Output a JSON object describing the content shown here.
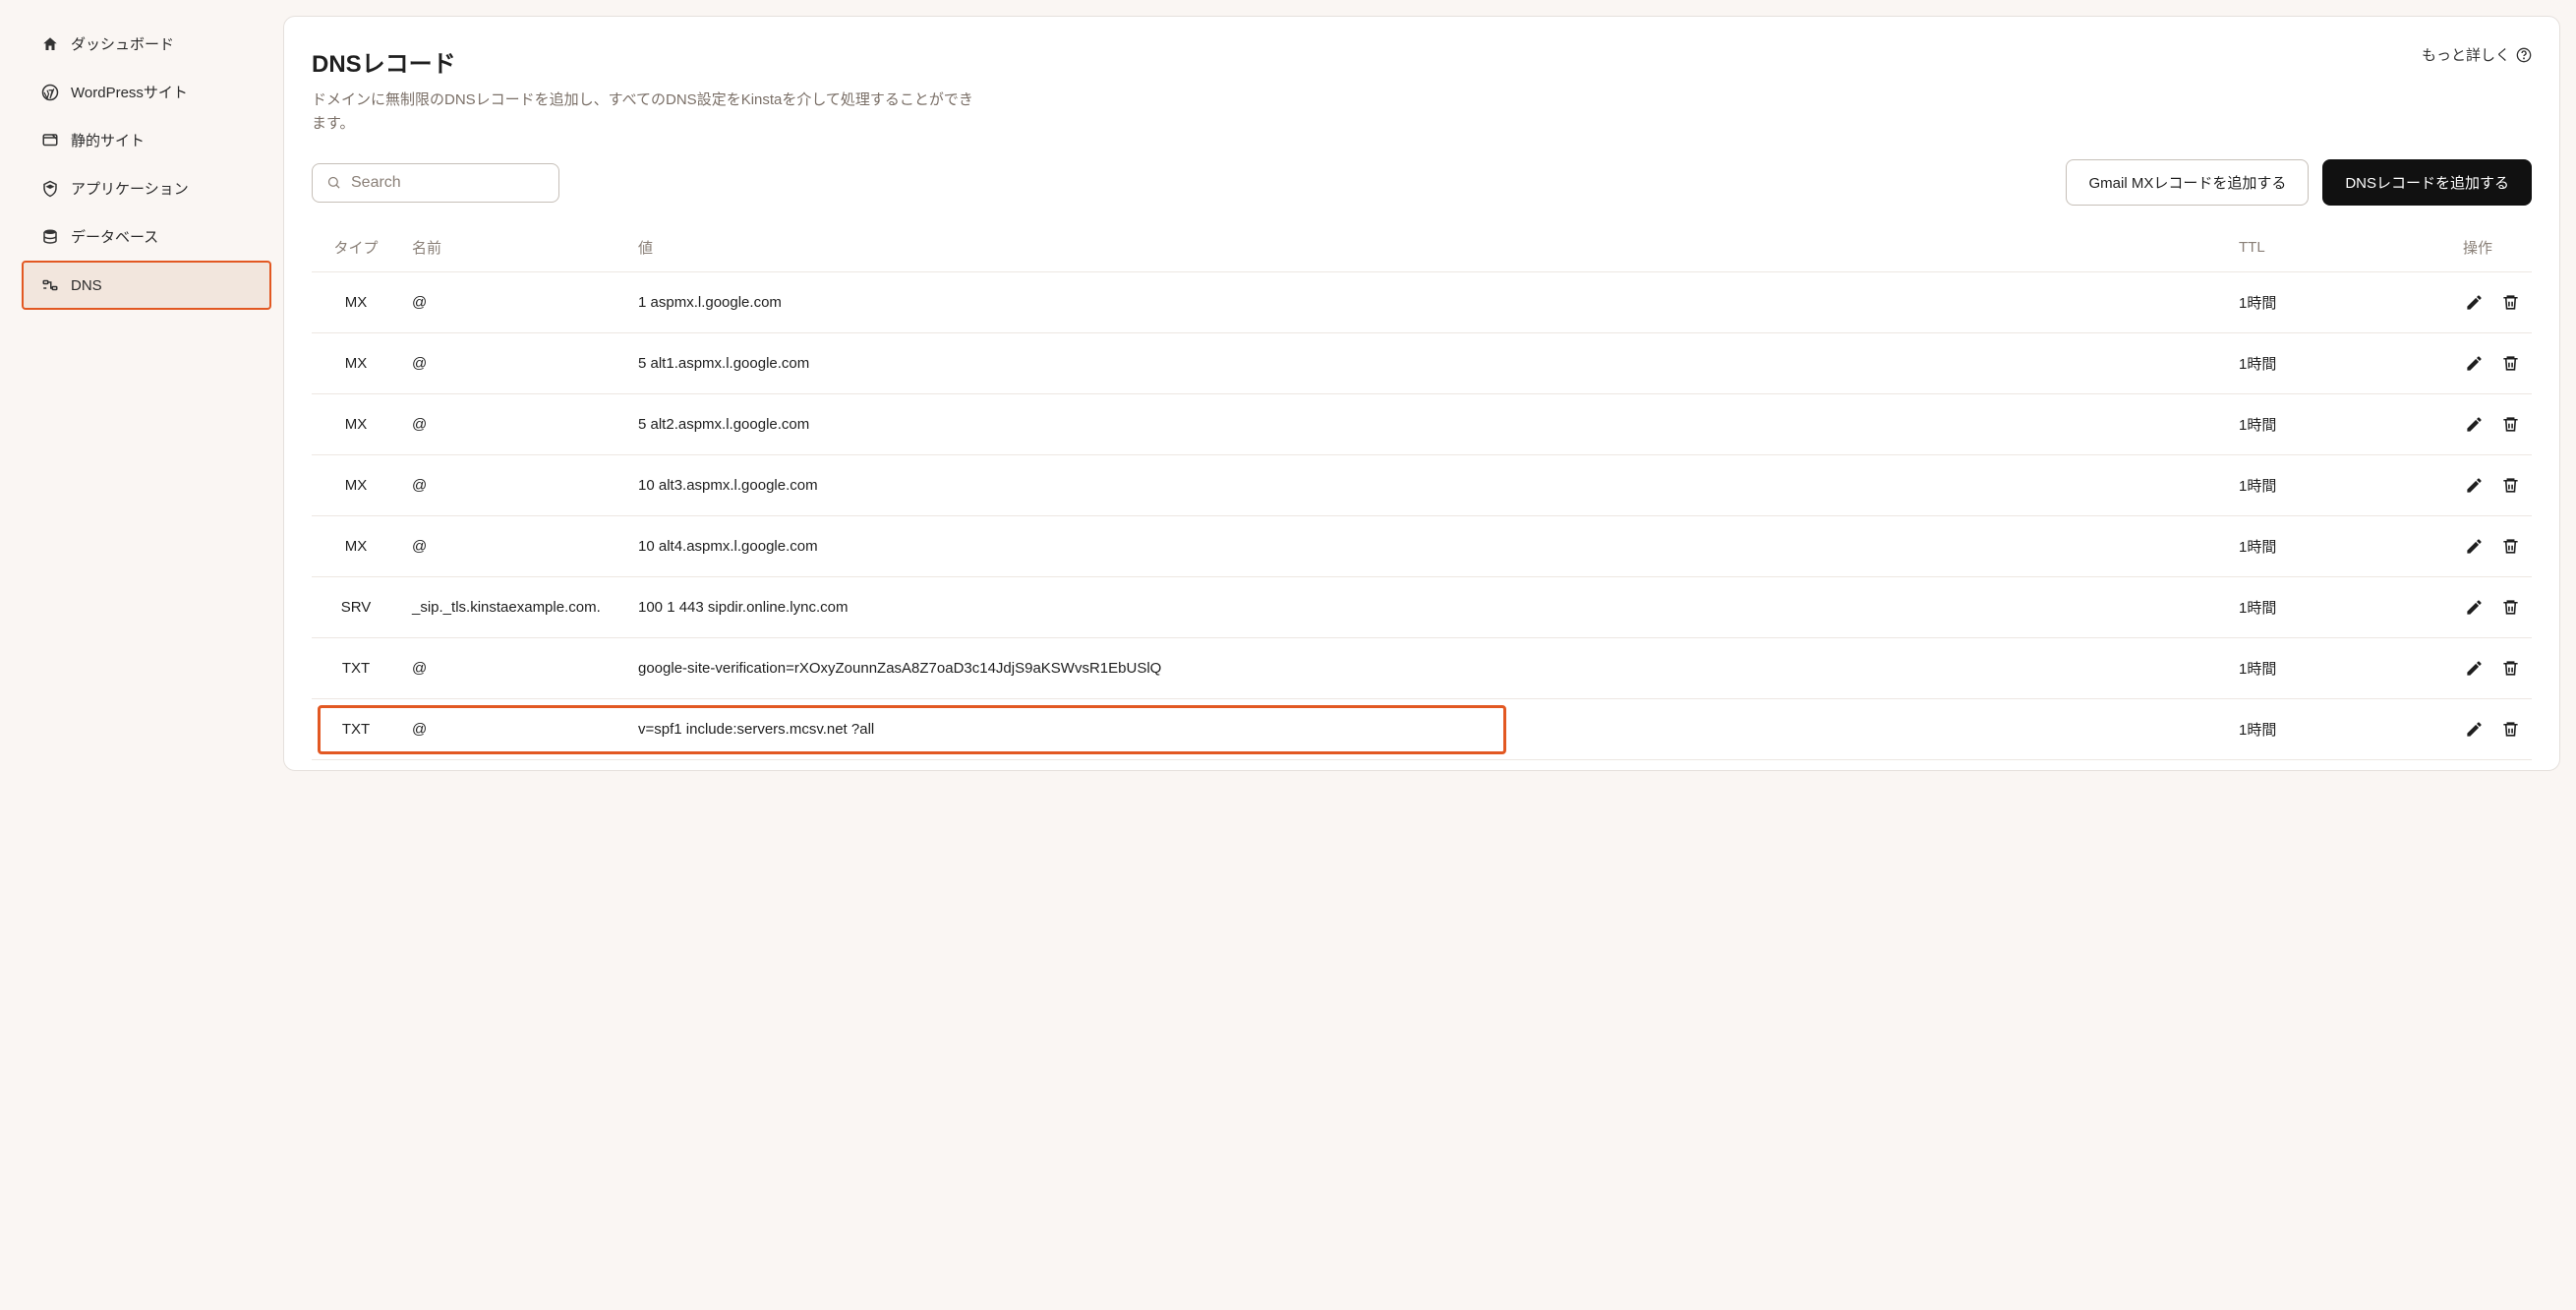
{
  "sidebar": {
    "items": [
      {
        "label": "ダッシュボード",
        "icon": "home"
      },
      {
        "label": "WordPressサイト",
        "icon": "wordpress"
      },
      {
        "label": "静的サイト",
        "icon": "static"
      },
      {
        "label": "アプリケーション",
        "icon": "app"
      },
      {
        "label": "データベース",
        "icon": "database"
      },
      {
        "label": "DNS",
        "icon": "dns",
        "active": true
      }
    ]
  },
  "header": {
    "title": "DNSレコード",
    "subtitle": "ドメインに無制限のDNSレコードを追加し、すべてのDNS設定をKinstaを介して処理することができます。",
    "learn_more": "もっと詳しく"
  },
  "search": {
    "placeholder": "Search"
  },
  "toolbar": {
    "gmail_button": "Gmail MXレコードを追加する",
    "add_button": "DNSレコードを追加する"
  },
  "columns": {
    "type": "タイプ",
    "name": "名前",
    "value": "値",
    "ttl": "TTL",
    "actions": "操作"
  },
  "records": [
    {
      "type": "MX",
      "name": "@",
      "value": "1 aspmx.l.google.com",
      "ttl": "1時間"
    },
    {
      "type": "MX",
      "name": "@",
      "value": "5 alt1.aspmx.l.google.com",
      "ttl": "1時間"
    },
    {
      "type": "MX",
      "name": "@",
      "value": "5 alt2.aspmx.l.google.com",
      "ttl": "1時間"
    },
    {
      "type": "MX",
      "name": "@",
      "value": "10 alt3.aspmx.l.google.com",
      "ttl": "1時間"
    },
    {
      "type": "MX",
      "name": "@",
      "value": "10 alt4.aspmx.l.google.com",
      "ttl": "1時間"
    },
    {
      "type": "SRV",
      "name": "_sip._tls.kinstaexample.com.",
      "value": "100 1 443 sipdir.online.lync.com",
      "ttl": "1時間"
    },
    {
      "type": "TXT",
      "name": "@",
      "value": "google-site-verification=rXOxyZounnZasA8Z7oaD3c14JdjS9aKSWvsR1EbUSlQ",
      "ttl": "1時間"
    },
    {
      "type": "TXT",
      "name": "@",
      "value": "v=spf1 include:servers.mcsv.net ?all",
      "ttl": "1時間",
      "highlighted": true
    }
  ]
}
